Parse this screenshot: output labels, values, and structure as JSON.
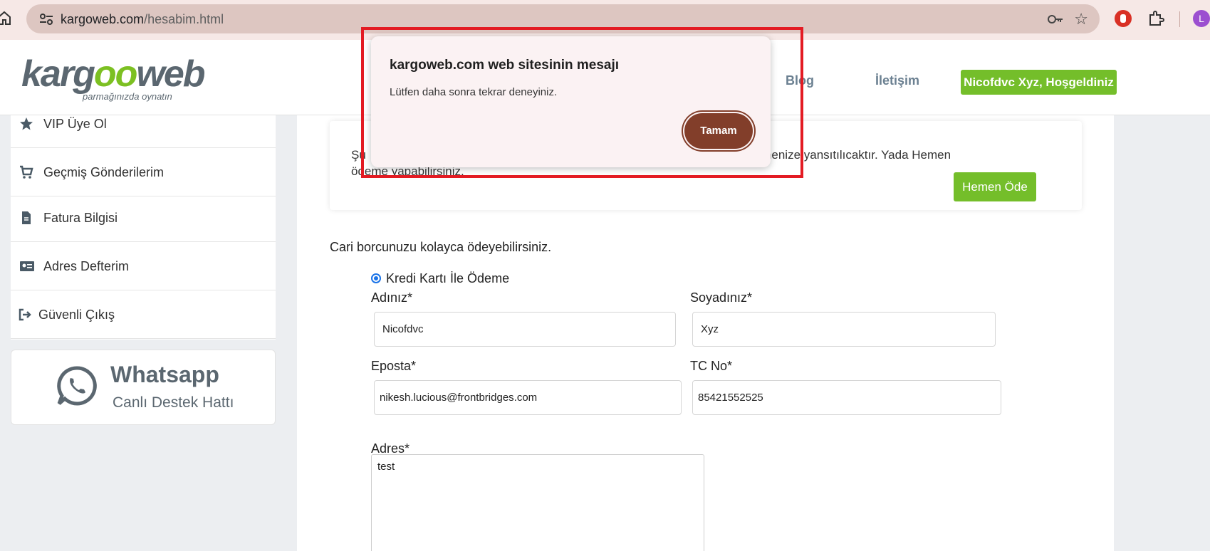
{
  "browser": {
    "url_host": "kargoweb.com",
    "url_path": "/hesabim.html",
    "profile_initial": "L"
  },
  "header": {
    "logo_part1": "karg",
    "logo_part2": "oo",
    "logo_part3": "web",
    "logo_tagline": "parmağınızda oynatın",
    "nav": [
      {
        "label": "Blog"
      },
      {
        "label": "İletişim"
      }
    ],
    "welcome": "Nicofdvc Xyz, Hoşgeldiniz"
  },
  "sidebar": {
    "items": [
      {
        "label": "VIP Üye Ol",
        "icon": "star-icon"
      },
      {
        "label": "Geçmiş Gönderilerim",
        "icon": "cart-icon"
      },
      {
        "label": "Fatura Bilgisi",
        "icon": "document-icon"
      },
      {
        "label": "Adres Defterim",
        "icon": "id-card-icon"
      },
      {
        "label": "Güvenli Çıkış",
        "icon": "logout-icon"
      }
    ],
    "whatsapp": {
      "title": "Whatsapp",
      "subtitle": "Canlı Destek Hattı"
    }
  },
  "main": {
    "info_text": "Şu anki bakiyeniz bir sonraki döneme ait ödemenize yansıtılıcaktır. Yada Hemen ödeme yapabilirsiniz.",
    "info_text_visible_right": "e ait ödemenize yansıtılıcaktır. Yada Hemen",
    "info_text_visible_bottom": "ödeme yapabilirsiniz.",
    "info_text_visible_left": "Şu",
    "pay_now_button": "Hemen Öde",
    "cari_text": "Cari borcunuzu kolayca ödeyebilirsiniz.",
    "payment_option": "Kredi Kartı İle Ödeme",
    "form": {
      "first_name_label": "Adınız*",
      "first_name_value": "Nicofdvc",
      "last_name_label": "Soyadınız*",
      "last_name_value": "Xyz",
      "email_label": "Eposta*",
      "email_value": "nikesh.lucious@frontbridges.com",
      "tc_label": "TC No*",
      "tc_value": "85421552525",
      "address_label": "Adres*",
      "address_value": "test"
    }
  },
  "dialog": {
    "title": "kargoweb.com web sitesinin mesajı",
    "message": "Lütfen daha sonra tekrar deneyiniz.",
    "ok_button": "Tamam"
  },
  "colors": {
    "accent_green": "#74be2a",
    "dialog_button": "#823e2a",
    "highlight_red": "#e31b23"
  }
}
